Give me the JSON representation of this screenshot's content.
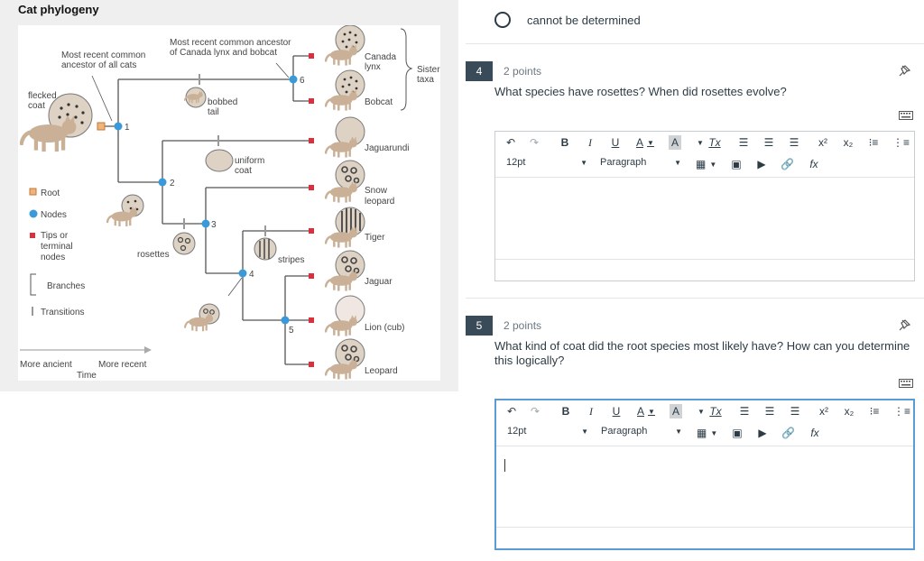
{
  "figure": {
    "title": "Cat phylogeny",
    "annotations": {
      "mrca_all_cats": [
        "Most recent common",
        "ancestor of all cats"
      ],
      "mrca_lynx_bobcat": [
        "Most recent common ancestor",
        "of Canada lynx and bobcat"
      ],
      "flecked_coat": [
        "flecked",
        "coat"
      ],
      "bobbed_tail": [
        "bobbed",
        "tail"
      ],
      "uniform_coat": [
        "uniform",
        "coat"
      ],
      "rosettes": "rosettes",
      "stripes": "stripes",
      "sister_taxa": [
        "Sister",
        "taxa"
      ]
    },
    "node_numbers": [
      "1",
      "2",
      "3",
      "4",
      "5",
      "6"
    ],
    "taxa": [
      {
        "label": [
          "Canada",
          "lynx"
        ]
      },
      {
        "label": [
          "Bobcat"
        ]
      },
      {
        "label": [
          "Jaguarundi"
        ]
      },
      {
        "label": [
          "Snow",
          "leopard"
        ]
      },
      {
        "label": [
          "Tiger"
        ]
      },
      {
        "label": [
          "Jaguar"
        ]
      },
      {
        "label": [
          "Lion (cub)"
        ]
      },
      {
        "label": [
          "Leopard"
        ]
      }
    ],
    "legend": {
      "root": "Root",
      "nodes": "Nodes",
      "tips": [
        "Tips or",
        "terminal",
        "nodes"
      ],
      "branches": "Branches",
      "transitions": "Transitions"
    },
    "time_axis": {
      "more_ancient": "More ancient",
      "more_recent": "More recent",
      "time": "Time"
    },
    "colors": {
      "root": "#f0b47a",
      "node": "#3a9ad9",
      "tip": "#d9303b",
      "branch": "#555555",
      "cat": "#c9b096"
    }
  },
  "quiz": {
    "prev_option": {
      "label": "cannot be determined"
    },
    "questions": [
      {
        "number": "4",
        "points": "2 points",
        "text": "What species have rosettes? When did rosettes evolve?"
      },
      {
        "number": "5",
        "points": "2 points",
        "text": "What kind of coat did the root species most likely have? How can you determine this logically?"
      }
    ],
    "editor": {
      "font_size": "12pt",
      "block_format": "Paragraph",
      "toolbar_icons": [
        "undo-icon",
        "redo-icon",
        "bold-icon",
        "italic-icon",
        "underline-icon",
        "text-color-icon",
        "highlight-color-icon",
        "clear-formatting-icon",
        "align-left-icon",
        "align-center-icon",
        "align-right-icon",
        "superscript-icon",
        "subscript-icon",
        "bullet-list-icon",
        "numbered-list-icon",
        "table-icon",
        "image-icon",
        "media-icon",
        "link-icon",
        "equation-icon",
        "keyboard-icon",
        "pin-icon"
      ]
    }
  }
}
